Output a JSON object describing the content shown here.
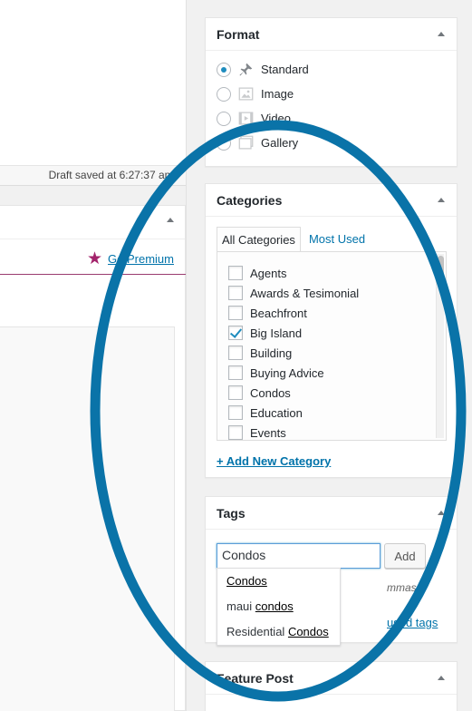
{
  "status": {
    "draft_saved": "Draft saved at 6:27:37 am."
  },
  "left_panel": {
    "go_premium": "Go Premium"
  },
  "format": {
    "title": "Format",
    "options": [
      {
        "label": "Standard",
        "icon": "pin-icon",
        "selected": true
      },
      {
        "label": "Image",
        "icon": "image-icon",
        "selected": false
      },
      {
        "label": "Video",
        "icon": "video-icon",
        "selected": false
      },
      {
        "label": "Gallery",
        "icon": "gallery-icon",
        "selected": false
      }
    ]
  },
  "categories": {
    "title": "Categories",
    "tabs": [
      "All Categories",
      "Most Used"
    ],
    "items": [
      {
        "label": "Agents",
        "checked": false
      },
      {
        "label": "Awards & Tesimonial",
        "checked": false
      },
      {
        "label": "Beachfront",
        "checked": false
      },
      {
        "label": "Big Island",
        "checked": true
      },
      {
        "label": "Building",
        "checked": false
      },
      {
        "label": "Buying Advice",
        "checked": false
      },
      {
        "label": "Condos",
        "checked": false
      },
      {
        "label": "Education",
        "checked": false
      },
      {
        "label": "Events",
        "checked": false
      }
    ],
    "add_new": "+ Add New Category"
  },
  "tags": {
    "title": "Tags",
    "input_value": "Condos",
    "add_label": "Add",
    "hint_fragment": "mmas",
    "used_fragment": "used tags",
    "suggestions": [
      {
        "prefix": "",
        "match": "Condos"
      },
      {
        "prefix": "maui ",
        "match": "condos"
      },
      {
        "prefix": "Residential ",
        "match": "Condos"
      }
    ]
  },
  "feature_post": {
    "title": "Feature Post"
  },
  "colors": {
    "accent": "#0073aa",
    "overlay_ring": "#0a73a8",
    "premium_star": "#a3236b"
  }
}
